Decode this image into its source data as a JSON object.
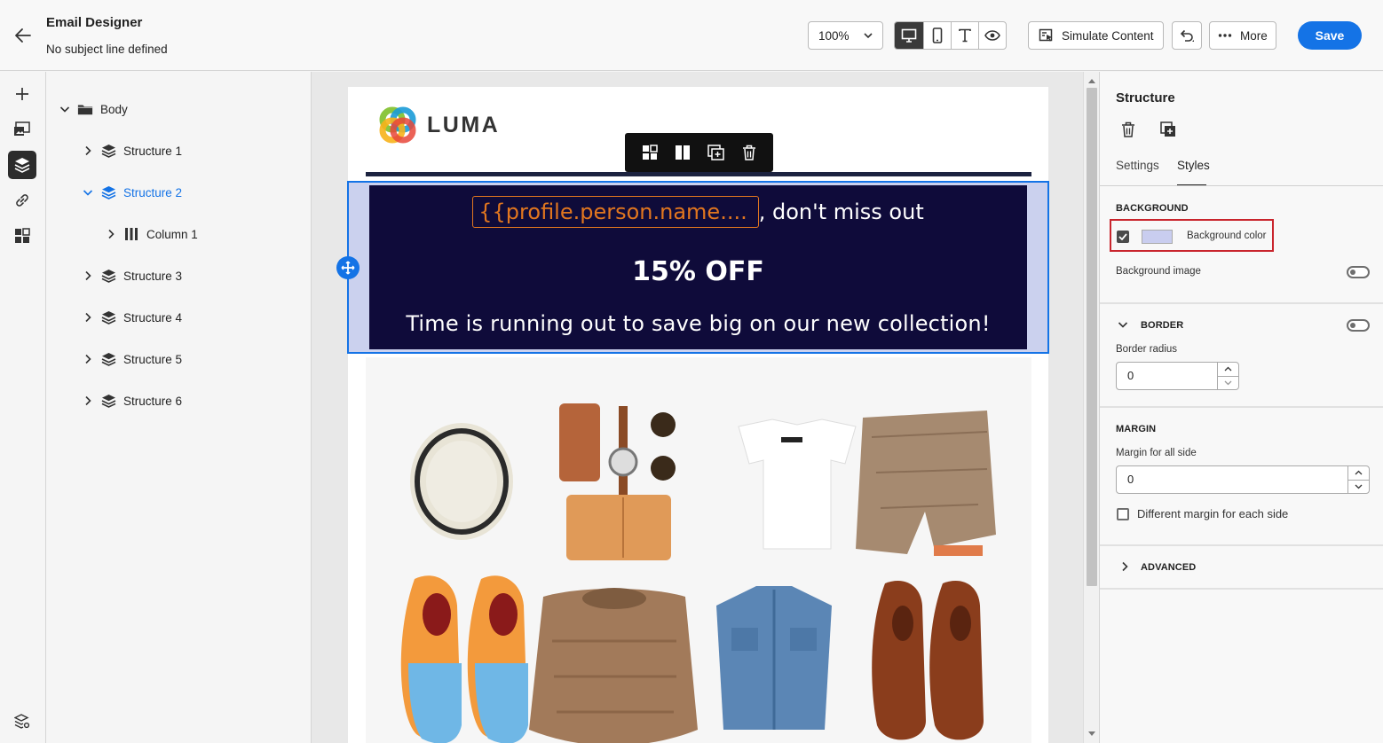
{
  "header": {
    "title": "Email Designer",
    "subtitle": "No subject line defined",
    "zoom": "100%",
    "simulate_label": "Simulate Content",
    "more_label": "More",
    "save_label": "Save"
  },
  "tree": {
    "root": "Body",
    "items": [
      {
        "label": "Structure 1"
      },
      {
        "label": "Structure 2"
      },
      {
        "label": "Column 1"
      },
      {
        "label": "Structure 3"
      },
      {
        "label": "Structure 4"
      },
      {
        "label": "Structure 5"
      },
      {
        "label": "Structure 6"
      }
    ]
  },
  "email": {
    "logo_text": "LUMA",
    "personalization_token": "{{profile.person.name....",
    "headline_suffix": ", don't miss out",
    "offer": "15% OFF",
    "tagline": "Time is running out to save big on our new collection!"
  },
  "panel": {
    "title": "Structure",
    "tabs": [
      "Settings",
      "Styles"
    ],
    "active_tab": "Styles",
    "background": {
      "section": "BACKGROUND",
      "color_label": "Background color",
      "color_checked": true,
      "color_value": "#c9cdef",
      "image_label": "Background image"
    },
    "border": {
      "section": "BORDER",
      "radius_label": "Border radius",
      "radius_value": "0"
    },
    "margin": {
      "section": "MARGIN",
      "all_label": "Margin for all side",
      "all_value": "0",
      "each_label": "Different margin for each side"
    },
    "advanced": {
      "section": "ADVANCED"
    }
  },
  "colors": {
    "accent": "#1473e6",
    "banner_bg": "#0f0b3a",
    "token_orange": "#e1761f",
    "highlight_red": "#c9252d"
  }
}
